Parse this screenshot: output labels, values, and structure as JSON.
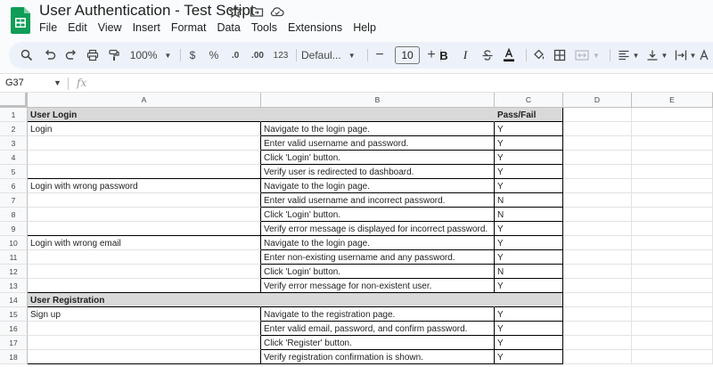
{
  "app": {
    "doc_title": "User Authentication - Test Script",
    "menu": [
      "File",
      "Edit",
      "View",
      "Insert",
      "Format",
      "Data",
      "Tools",
      "Extensions",
      "Help"
    ]
  },
  "toolbar": {
    "zoom": "100%",
    "currency": "$",
    "percent": "%",
    "dec_decrease": ".0",
    "dec_increase": ".00",
    "number_format": "123",
    "font": "Defaul...",
    "font_size": "10",
    "bold": "B",
    "italic": "I"
  },
  "formula_bar": {
    "name_box": "G37",
    "fx": "fx",
    "value": ""
  },
  "sheet": {
    "columns": [
      "A",
      "B",
      "C",
      "D",
      "E"
    ],
    "rows": [
      {
        "n": "1",
        "a": "User Login",
        "b": "",
        "c": "Pass/Fail",
        "type": "section"
      },
      {
        "n": "2",
        "a": "Login",
        "b": "Navigate to the login page.",
        "c": "Y",
        "type": "step"
      },
      {
        "n": "3",
        "a": "",
        "b": "Enter valid username and password.",
        "c": "Y",
        "type": "step"
      },
      {
        "n": "4",
        "a": "",
        "b": "Click 'Login' button.",
        "c": "Y",
        "type": "step"
      },
      {
        "n": "5",
        "a": "",
        "b": "Verify user is redirected to dashboard.",
        "c": "Y",
        "type": "step"
      },
      {
        "n": "6",
        "a": "Login with wrong password",
        "b": "Navigate to the login page.",
        "c": "Y",
        "type": "step"
      },
      {
        "n": "7",
        "a": "",
        "b": "Enter valid username and incorrect password.",
        "c": "N",
        "type": "step"
      },
      {
        "n": "8",
        "a": "",
        "b": "Click 'Login' button.",
        "c": "N",
        "type": "step"
      },
      {
        "n": "9",
        "a": "",
        "b": "Verify error message is displayed for incorrect password.",
        "c": "Y",
        "type": "step"
      },
      {
        "n": "10",
        "a": "Login with wrong email",
        "b": "Navigate to the login page.",
        "c": "Y",
        "type": "step"
      },
      {
        "n": "11",
        "a": "",
        "b": "Enter non-existing username and any password.",
        "c": "Y",
        "type": "step"
      },
      {
        "n": "12",
        "a": "",
        "b": "Click 'Login' button.",
        "c": "N",
        "type": "step"
      },
      {
        "n": "13",
        "a": "",
        "b": "Verify error message for non-existent user.",
        "c": "Y",
        "type": "step"
      },
      {
        "n": "14",
        "a": "User Registration",
        "b": "",
        "c": "",
        "type": "section"
      },
      {
        "n": "15",
        "a": "Sign up",
        "b": "Navigate to the registration page.",
        "c": "Y",
        "type": "step"
      },
      {
        "n": "16",
        "a": "",
        "b": "Enter valid email, password, and confirm password.",
        "c": "Y",
        "type": "step"
      },
      {
        "n": "17",
        "a": "",
        "b": "Click 'Register' button.",
        "c": "Y",
        "type": "step"
      },
      {
        "n": "18",
        "a": "",
        "b": "Verify registration confirmation is shown.",
        "c": "Y",
        "type": "step"
      }
    ]
  },
  "colors": {
    "toolbar_bg": "#edf2fa",
    "section_bg": "#d9d9d9",
    "sheets_green": "#0f9d58"
  }
}
